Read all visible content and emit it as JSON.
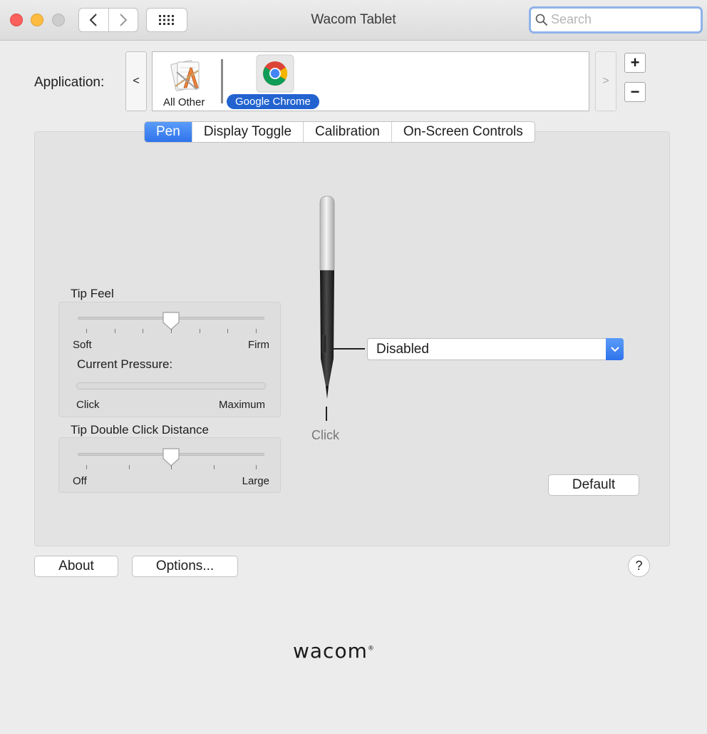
{
  "window": {
    "title": "Wacom Tablet",
    "search": {
      "value": "",
      "placeholder": "Search"
    }
  },
  "application": {
    "label": "Application:",
    "scroll_left": "<",
    "scroll_right": ">",
    "items": [
      {
        "name": "All Other",
        "icon": "all-other-apps-icon",
        "selected": false
      },
      {
        "name": "Google Chrome",
        "icon": "chrome-icon",
        "selected": true
      }
    ],
    "add": "+",
    "remove": "−"
  },
  "tabs": [
    {
      "label": "Pen",
      "active": true
    },
    {
      "label": "Display Toggle",
      "active": false
    },
    {
      "label": "Calibration",
      "active": false
    },
    {
      "label": "On-Screen Controls",
      "active": false
    }
  ],
  "pen": {
    "tip_feel": {
      "label": "Tip Feel",
      "min_label": "Soft",
      "max_label": "Firm",
      "position": 0.5,
      "ticks": 7
    },
    "current_pressure": {
      "label": "Current Pressure:",
      "min_label": "Click",
      "max_label": "Maximum",
      "value": 0
    },
    "tip_double_click": {
      "label": "Tip Double Click Distance",
      "min_label": "Off",
      "max_label": "Large",
      "position": 0.5,
      "ticks": 5
    },
    "side_button": {
      "value": "Disabled"
    },
    "tip_label": "Click",
    "default_button": "Default"
  },
  "footer": {
    "about": "About",
    "options": "Options...",
    "help": "?",
    "logo": "wacom",
    "logo_mark": "®"
  },
  "colors": {
    "accent": "#2f73ec",
    "close": "#fc605c",
    "minimize": "#fdbc40",
    "zoom_disabled": "#cdcdcd"
  }
}
